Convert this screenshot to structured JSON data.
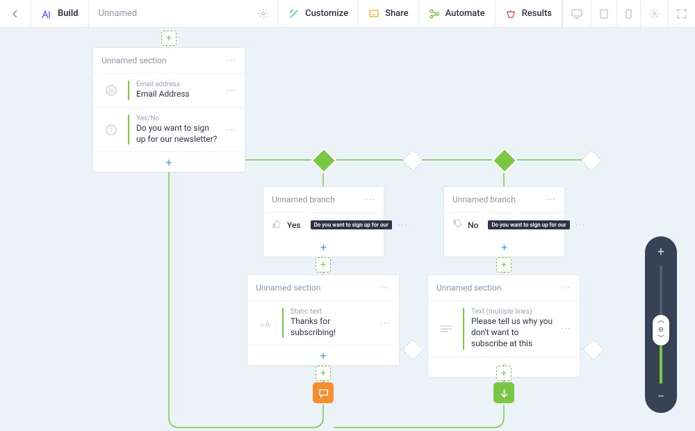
{
  "toolbar": {
    "tabs": {
      "build": "Build",
      "customize": "Customize",
      "share": "Share",
      "automate": "Automate",
      "results": "Results"
    },
    "form_title": "Unnamed"
  },
  "colors": {
    "accent_green": "#79c843",
    "accent_blue": "#4a9ff5",
    "orange": "#f68d2e",
    "purple": "#7a5cff",
    "red": "#e55a5a",
    "teal": "#3fc1b0",
    "gold": "#f4b23e"
  },
  "section_root": {
    "title": "Unnamed section",
    "fields": [
      {
        "type_label": "Email address",
        "text": "Email Address"
      },
      {
        "type_label": "Yes/No",
        "text": "Do you want to sign up for our newsletter?"
      }
    ]
  },
  "branch_yes": {
    "title": "Unnamed branch",
    "answer": "Yes",
    "chip": "Do you want to sign up for our"
  },
  "branch_no": {
    "title": "Unnamed branch",
    "answer": "No",
    "chip": "Do you want to sign up for our"
  },
  "section_yes_child": {
    "title": "Unnamed section",
    "field": {
      "type_label": "Static text",
      "text": "Thanks for subscribing!"
    }
  },
  "section_no_child": {
    "title": "Unnamed section",
    "field": {
      "type_label": "Text (multiple lines)",
      "text": "Please tell us why you don't want to subscribe at this"
    }
  }
}
